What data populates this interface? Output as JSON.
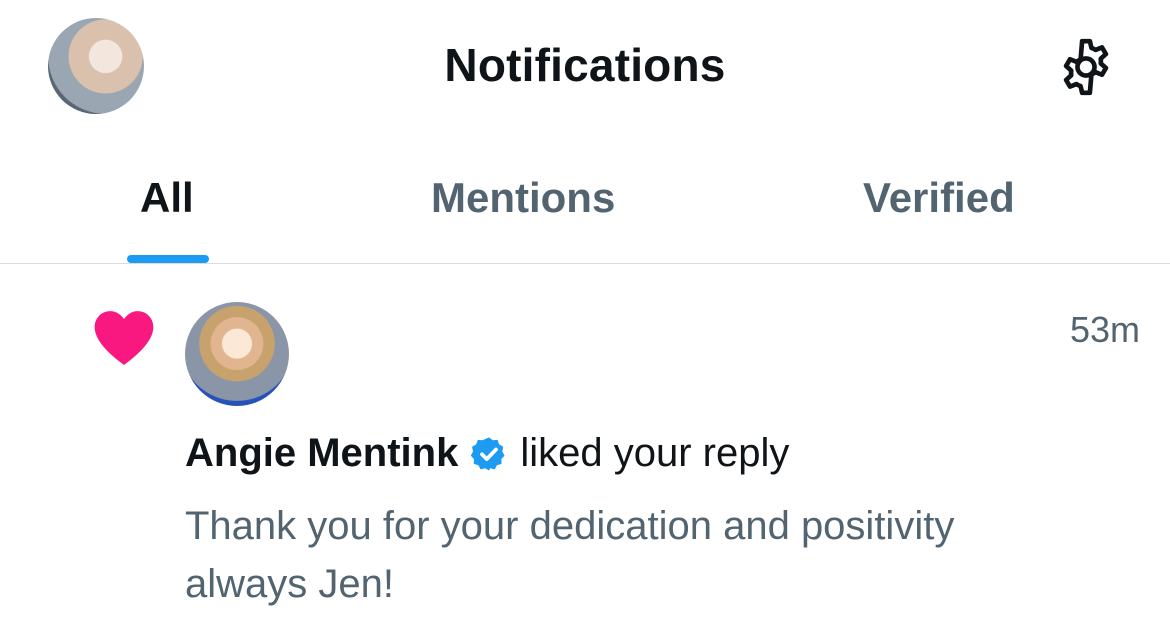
{
  "header": {
    "title": "Notifications",
    "profile_avatar": "profile-avatar",
    "settings_icon": "gear-icon"
  },
  "tabs": [
    {
      "label": "All",
      "active": true
    },
    {
      "label": "Mentions",
      "active": false
    },
    {
      "label": "Verified",
      "active": false
    }
  ],
  "notification": {
    "icon": "heart-icon",
    "icon_color": "#f91880",
    "user_name": "Angie Mentink",
    "verified": true,
    "verified_color": "#1d9bf0",
    "action": "liked your reply",
    "time": "53m",
    "text": "Thank you for your dedication and positivity always Jen!"
  },
  "colors": {
    "accent": "#1d9bf0",
    "text_primary": "#0f1419",
    "text_secondary": "#536471"
  }
}
